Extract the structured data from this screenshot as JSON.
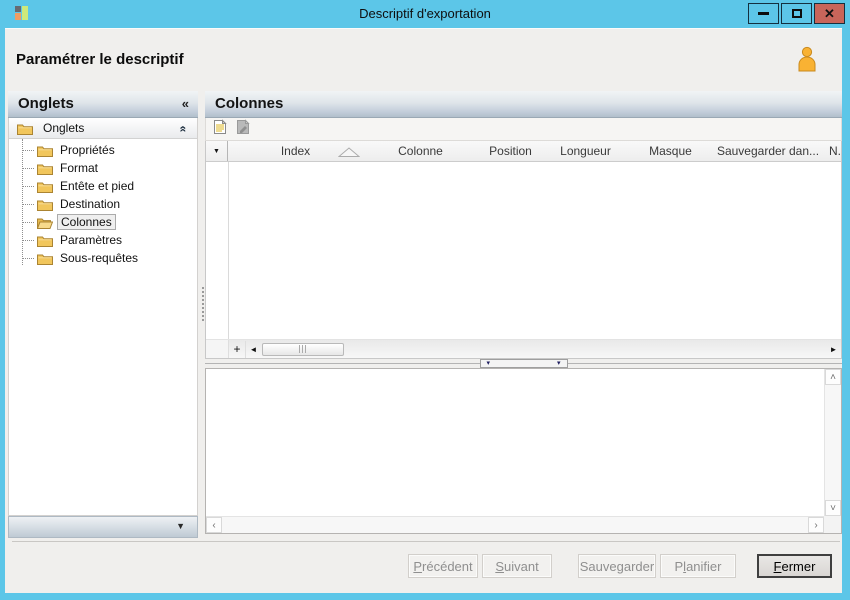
{
  "window": {
    "title": "Descriptif d'exportation",
    "controls": [
      "minimize-icon",
      "maximize-icon",
      "close-icon"
    ]
  },
  "glyphs": {
    "close": "✕",
    "collapse_left": "«",
    "collapse_up": "«",
    "dropdown": "▼",
    "indicator": "▼",
    "splitter_arrow": "▾",
    "scroll_left": "◄",
    "scroll_right": "►",
    "scroll_up": "˄",
    "scroll_down": "˅",
    "scroll_left_thin": "‹",
    "scroll_right_thin": "›"
  },
  "colors": {
    "titlebar": "#5cc6e8",
    "close_button": "#c8655a",
    "panel_header_gradient_bottom": "#b1bfcb",
    "folder": "#f1c65c",
    "user_icon": "#f9a825"
  },
  "header": {
    "title": "Paramétrer le descriptif"
  },
  "sidebar": {
    "title": "Onglets",
    "group_label": "Onglets",
    "items": [
      {
        "label": "Propriétés",
        "selected": false
      },
      {
        "label": "Format",
        "selected": false
      },
      {
        "label": "Entête et pied",
        "selected": false
      },
      {
        "label": "Destination",
        "selected": false
      },
      {
        "label": "Colonnes",
        "selected": true
      },
      {
        "label": "Paramètres",
        "selected": false
      },
      {
        "label": "Sous-requêtes",
        "selected": false
      }
    ]
  },
  "main": {
    "title": "Colonnes",
    "toolbar_icons": [
      "new-descriptor-icon",
      "edit-descriptor-disabled-icon"
    ],
    "grid": {
      "columns": [
        "Index",
        "Colonne",
        "Position",
        "Longueur",
        "Masque",
        "Sauvegarder dan...",
        "N..."
      ],
      "rows": [],
      "add_button_label": "+"
    }
  },
  "footer": {
    "buttons": [
      {
        "name": "precedent",
        "pre": "",
        "u": "P",
        "post": "récédent",
        "enabled": false
      },
      {
        "name": "suivant",
        "pre": "",
        "u": "S",
        "post": "uivant",
        "enabled": false
      },
      {
        "name": "sauvegarder",
        "pre": "",
        "u": "",
        "post": "Sauvegarder",
        "enabled": false
      },
      {
        "name": "planifier",
        "pre": "P",
        "u": "l",
        "post": "anifier",
        "enabled": false
      },
      {
        "name": "fermer",
        "pre": "",
        "u": "F",
        "post": "ermer",
        "enabled": true
      }
    ]
  }
}
